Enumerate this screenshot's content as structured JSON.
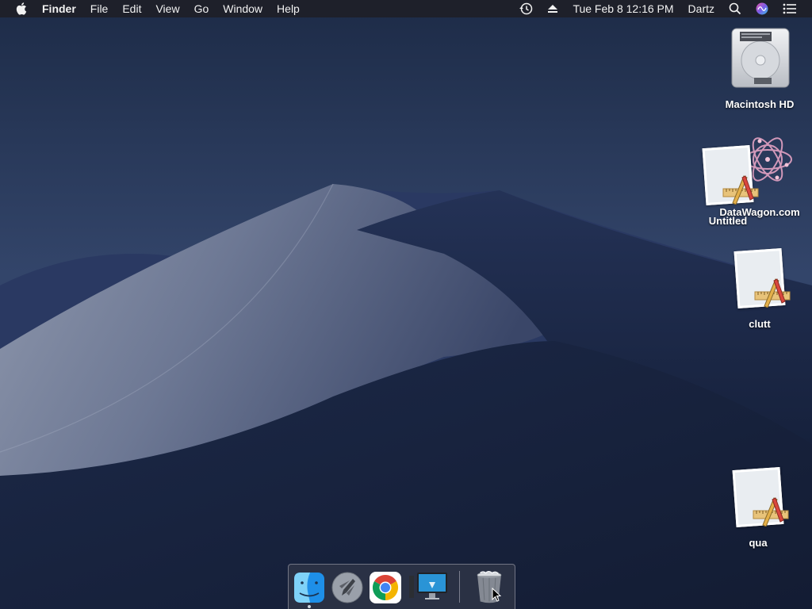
{
  "menubar": {
    "app_name": "Finder",
    "menus": [
      "File",
      "Edit",
      "View",
      "Go",
      "Window",
      "Help"
    ],
    "status": {
      "datetime": "Tue Feb 8  12:16 PM",
      "user": "Dartz"
    }
  },
  "desktop": {
    "icons": {
      "macintosh_hd": "Macintosh HD",
      "datawagon": "DataWagon.com",
      "untitled": "Untitled",
      "clutt": "clutt",
      "qua": "qua"
    }
  },
  "dock": {
    "apps": [
      "Finder",
      "Launchpad",
      "Google Chrome",
      "Screen Sharing",
      "Trash"
    ]
  }
}
